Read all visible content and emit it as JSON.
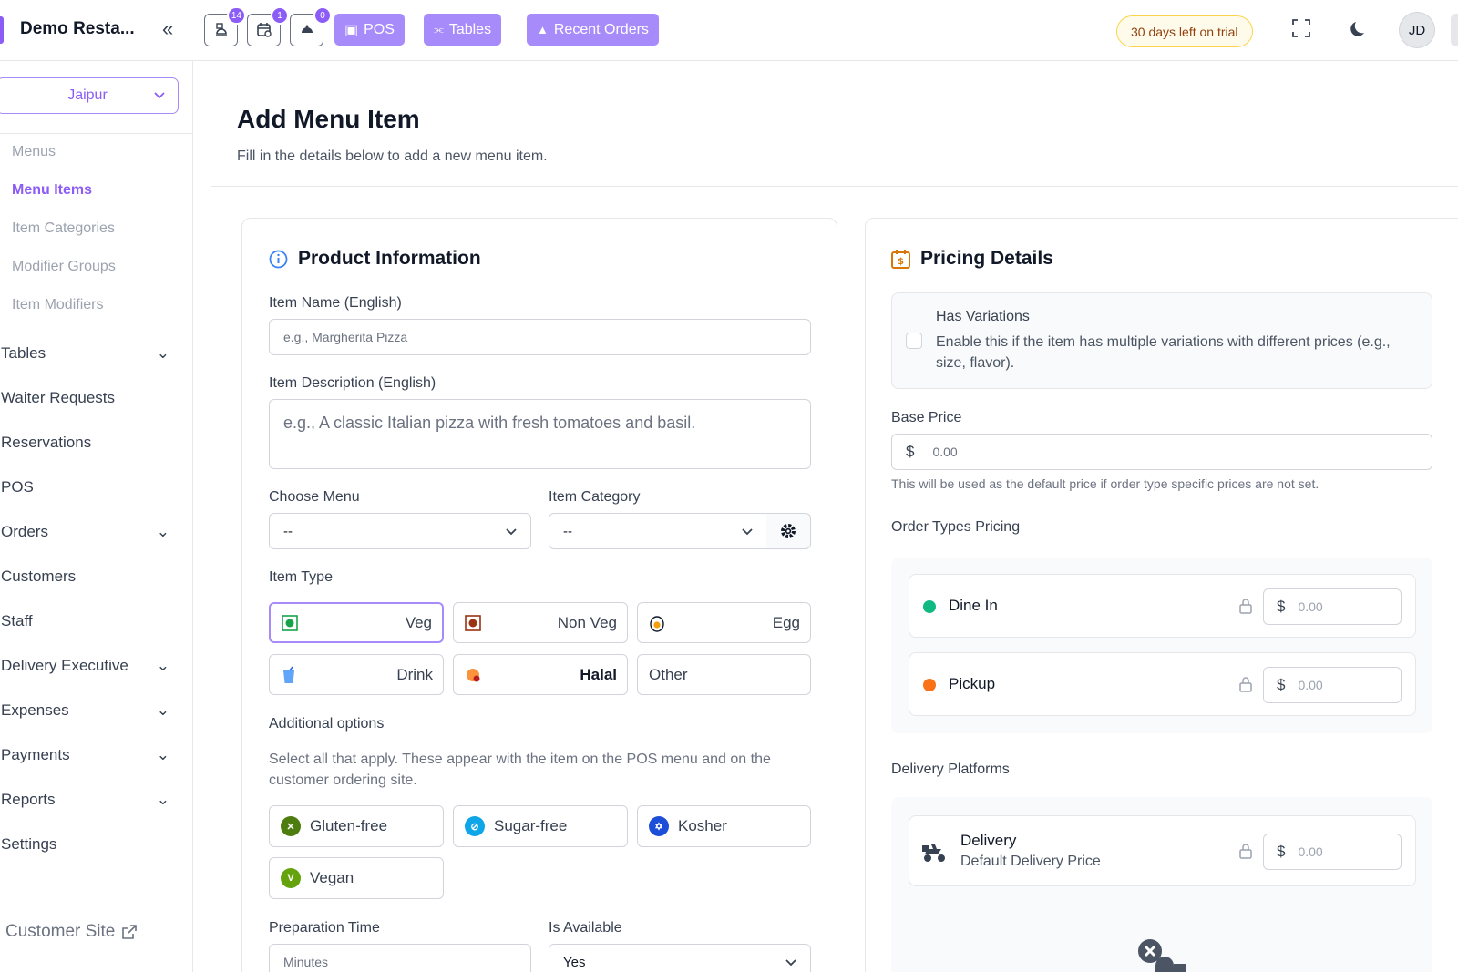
{
  "topbar": {
    "restaurant_name": "Demo Resta...",
    "badges": [
      "14",
      "1",
      "0"
    ],
    "pos_label": "POS",
    "tables_label": "Tables",
    "recent_orders_label": "Recent Orders",
    "trial_text": "30 days left on trial",
    "avatar_initials": "JD"
  },
  "sidebar": {
    "branch": "Jaipur",
    "menu_sub": [
      "Menus",
      "Menu Items",
      "Item Categories",
      "Modifier Groups",
      "Item Modifiers"
    ],
    "nav": [
      "Tables",
      "Waiter Requests",
      "Reservations",
      "POS",
      "Orders",
      "Customers",
      "Staff",
      "Delivery Executive",
      "Expenses",
      "Payments",
      "Reports",
      "Settings"
    ],
    "customer_site": "Customer Site"
  },
  "page": {
    "title": "Add Menu Item",
    "subtitle": "Fill in the details below to add a new menu item."
  },
  "product": {
    "title": "Product Information",
    "name_label": "Item Name (English)",
    "name_placeholder": "e.g., Margherita Pizza",
    "desc_label": "Item Description (English)",
    "desc_placeholder": "e.g., A classic Italian pizza with fresh tomatoes and basil.",
    "menu_label": "Choose Menu",
    "menu_value": "--",
    "category_label": "Item Category",
    "category_value": "--",
    "type_label": "Item Type",
    "types": [
      "Veg",
      "Non Veg",
      "Egg",
      "Drink",
      "Halal",
      "Other"
    ],
    "selected_type": "Veg",
    "additional_label": "Additional options",
    "additional_help": "Select all that apply. These appear with the item on the POS menu and on the customer ordering site.",
    "options": [
      "Gluten-free",
      "Sugar-free",
      "Kosher",
      "Vegan"
    ],
    "prep_label": "Preparation Time",
    "prep_placeholder": "Minutes",
    "available_label": "Is Available",
    "available_value": "Yes"
  },
  "pricing": {
    "title": "Pricing Details",
    "variations_title": "Has Variations",
    "variations_help": "Enable this if the item has multiple variations with different prices (e.g., size, flavor).",
    "base_label": "Base Price",
    "currency": "$",
    "base_placeholder": "0.00",
    "base_help": "This will be used as the default price if order type specific prices are not set.",
    "order_types_label": "Order Types Pricing",
    "order_types": [
      {
        "name": "Dine In",
        "color": "#10b981",
        "placeholder": "0.00"
      },
      {
        "name": "Pickup",
        "color": "#f97316",
        "placeholder": "0.00"
      }
    ],
    "delivery_label": "Delivery Platforms",
    "delivery_name": "Delivery",
    "delivery_sub": "Default Delivery Price",
    "delivery_placeholder": "0.00"
  },
  "colors": {
    "accent": "#8b5cf6",
    "accent_light": "#a78bfa"
  }
}
